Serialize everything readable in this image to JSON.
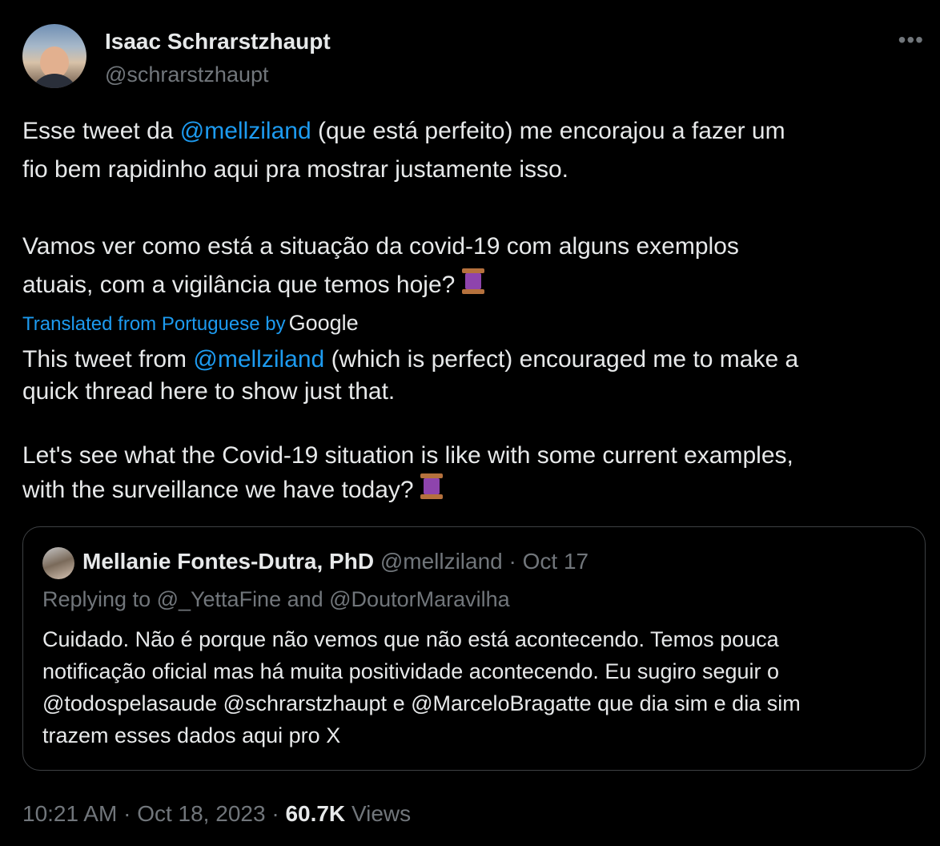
{
  "author": {
    "name": "Isaac Schrarstzhaupt",
    "handle": "@schrarstzhaupt"
  },
  "menu_icon": "more-horizontal-icon",
  "original_text": {
    "line1_pre": "Esse tweet da ",
    "mention1": "@mellziland",
    "line1_post": " (que está perfeito) me encorajou a fazer um",
    "line2": "fio bem rapidinho aqui pra mostrar justamente isso.",
    "line3": "Vamos ver como está a situação da covid-19 com alguns exemplos",
    "line4": "atuais, com a vigilância que temos hoje? "
  },
  "translation": {
    "label": "Translated from Portuguese by",
    "provider": "Google",
    "line1_pre": "This tweet from ",
    "mention1": "@mellziland",
    "line1_post": " (which is perfect) encouraged me to make a",
    "line2": "quick thread here to show just that.",
    "line3": "Let's see what the Covid-19 situation is like with some current examples,",
    "line4": "with the surveillance we have today? "
  },
  "emoji": "spool-of-thread-icon",
  "quoted_tweet": {
    "name": "Mellanie Fontes-Dutra, PhD",
    "handle": "@mellziland",
    "date": "Oct 17",
    "separator": "·",
    "replying": "Replying to @_YettaFine and @DoutorMaravilha",
    "line1": "Cuidado. Não é porque não vemos que não está acontecendo. Temos pouca",
    "line2": "notificação oficial mas há muita positividade acontecendo. Eu sugiro seguir o",
    "line3": "@todospelasaude @schrarstzhaupt e @MarceloBragatte que dia sim e dia sim",
    "line4": "trazem esses dados aqui pro X"
  },
  "footer": {
    "time": "10:21 AM",
    "date": "Oct 18, 2023",
    "separator": "·",
    "views_count": "60.7K",
    "views_label": "Views"
  },
  "colors": {
    "background": "#000000",
    "text": "#e7e9ea",
    "muted": "#71767b",
    "link": "#1d9bf0",
    "border": "#3e4144"
  }
}
